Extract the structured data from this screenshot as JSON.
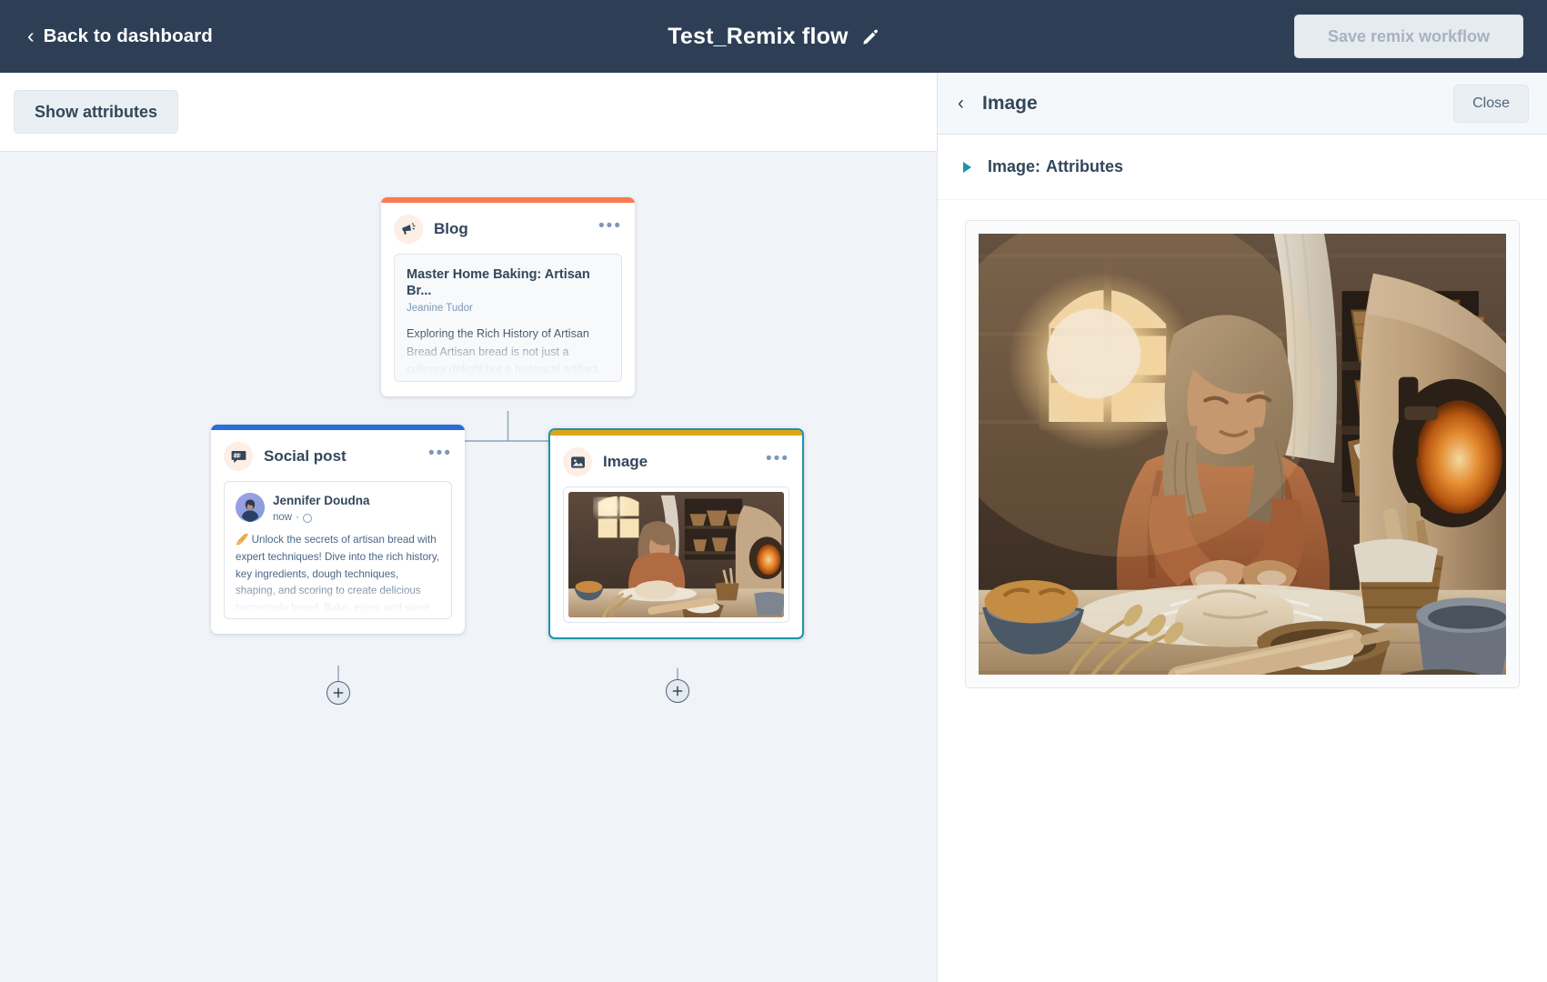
{
  "topbar": {
    "back_label": "Back to dashboard",
    "back_icon": "chevron-left-icon",
    "flow_title": "Test_Remix flow",
    "edit_icon": "pencil-icon",
    "save_label": "Save remix workflow",
    "save_disabled": true,
    "bg_color": "#2e3f55"
  },
  "toolbar": {
    "show_attributes_label": "Show attributes"
  },
  "canvas": {
    "nodes": [
      {
        "id": "blog",
        "type_label": "Blog",
        "icon": "megaphone-icon",
        "accent_color": "#f97b4f",
        "menu_icon": "ellipsis-icon",
        "preview": {
          "headline": "Master Home Baking: Artisan Br...",
          "author": "Jeanine Tudor",
          "body": "Exploring the Rich History of Artisan Bread Artisan bread is not just a culinary delight but a historical artifact, tracing its roots back to ancient Europe. This is where the"
        }
      },
      {
        "id": "social",
        "type_label": "Social post",
        "icon": "social-chat-icon",
        "accent_color": "#2a6ddb",
        "menu_icon": "ellipsis-icon",
        "preview": {
          "author": "Jennifer Doudna",
          "timestamp": "now",
          "separator": "·",
          "audience_icon": "globe-icon",
          "body": "🥖 Unlock the secrets of artisan bread with expert techniques! Dive into the rich history, key ingredients, dough techniques, shaping, and scoring to create delicious homemade bread. Bake, enjoy, and savor the satisfaction of your own"
        }
      },
      {
        "id": "image",
        "type_label": "Image",
        "icon": "picture-icon",
        "accent_color": "#e0a419",
        "selected": true,
        "selected_border_color": "#1b94a7",
        "menu_icon": "ellipsis-icon"
      }
    ],
    "add_buttons": [
      {
        "id": "add-under-social",
        "icon": "plus-icon"
      },
      {
        "id": "add-under-image",
        "icon": "plus-icon"
      }
    ],
    "connector_color": "#8da2bb",
    "background_color": "#f0f3f7"
  },
  "panel": {
    "back_icon": "chevron-left-icon",
    "title": "Image",
    "close_label": "Close",
    "attributes_section": {
      "caret_icon": "caret-right-icon",
      "prefix": "Image:",
      "label": "Attributes",
      "expanded": false
    },
    "preview_image_alt": "Woman in a headscarf kneading bread dough on a flour-dusted wooden table in a rustic stone bakery with a wood-fired oven"
  }
}
